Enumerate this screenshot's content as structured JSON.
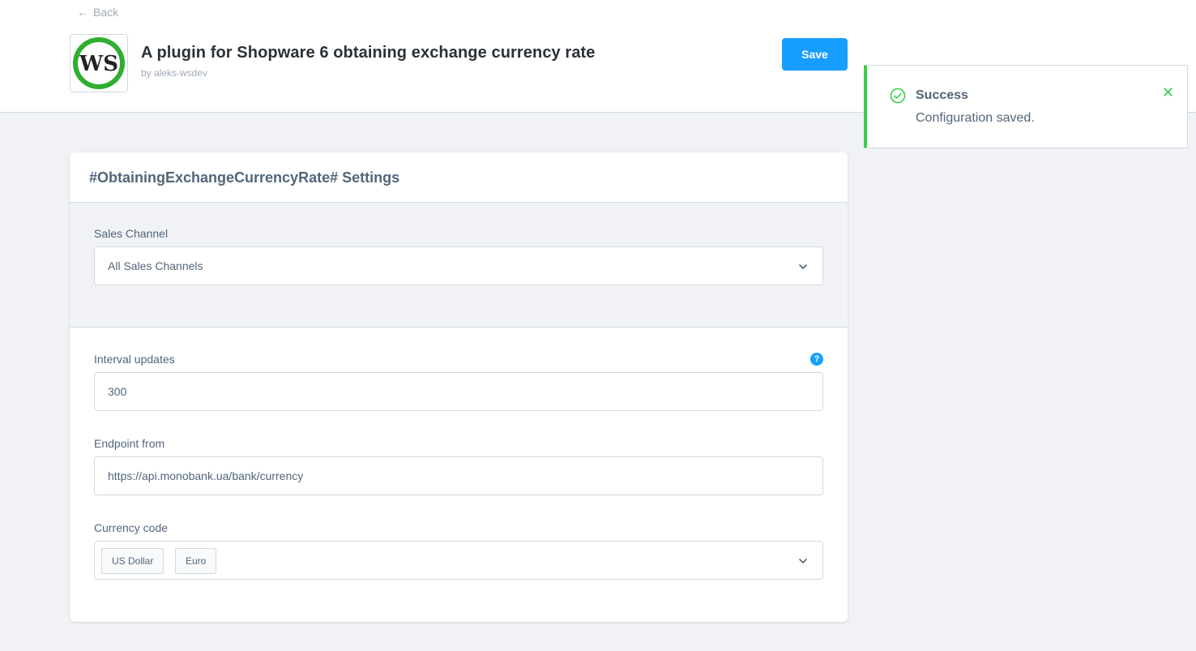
{
  "header": {
    "back_label": "Back",
    "plugin_title": "A plugin for Shopware 6 obtaining exchange currency rate",
    "author": "by aleks-wsdev",
    "save_label": "Save",
    "logo_text": "WS"
  },
  "toast": {
    "title": "Success",
    "message": "Configuration saved.",
    "accent_color": "#37d046"
  },
  "settings": {
    "title": "#ObtainingExchangeCurrencyRate# Settings",
    "sales_channel": {
      "label": "Sales Channel",
      "value": "All Sales Channels"
    },
    "interval": {
      "label": "Interval updates",
      "value": "300",
      "help_glyph": "?"
    },
    "endpoint": {
      "label": "Endpoint from",
      "value": "https://api.monobank.ua/bank/currency"
    },
    "currency": {
      "label": "Currency code",
      "tags": [
        "US Dollar",
        "Euro"
      ]
    }
  },
  "colors": {
    "primary": "#189eff",
    "success": "#37d046",
    "text": "#52667a"
  }
}
